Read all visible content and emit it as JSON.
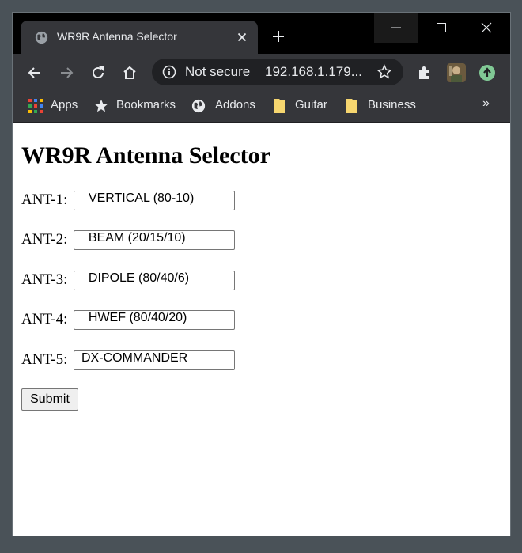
{
  "browser": {
    "tab_title": "WR9R Antenna Selector",
    "address_security": "Not secure",
    "address_url": "192.168.1.179...",
    "bookmarks": [
      {
        "label": "Apps",
        "icon": "apps-grid-icon"
      },
      {
        "label": "Bookmarks",
        "icon": "star-icon"
      },
      {
        "label": "Addons",
        "icon": "globe-icon"
      },
      {
        "label": "Guitar",
        "icon": "folder-icon"
      },
      {
        "label": "Business",
        "icon": "folder-icon"
      }
    ],
    "bookmarks_overflow": "»"
  },
  "page": {
    "title": "WR9R Antenna Selector",
    "antennas": [
      {
        "label": "ANT-1:",
        "value": "  VERTICAL (80-10)"
      },
      {
        "label": "ANT-2:",
        "value": "  BEAM (20/15/10)"
      },
      {
        "label": "ANT-3:",
        "value": "  DIPOLE (80/40/6)"
      },
      {
        "label": "ANT-4:",
        "value": "  HWEF (80/40/20)"
      },
      {
        "label": "ANT-5:",
        "value": "DX-COMMANDER"
      }
    ],
    "submit_label": "Submit"
  },
  "colors": {
    "tab_active": "#35363a",
    "titlebar": "#000000",
    "text_light": "#e8eaed",
    "page_bg": "#ffffff"
  }
}
